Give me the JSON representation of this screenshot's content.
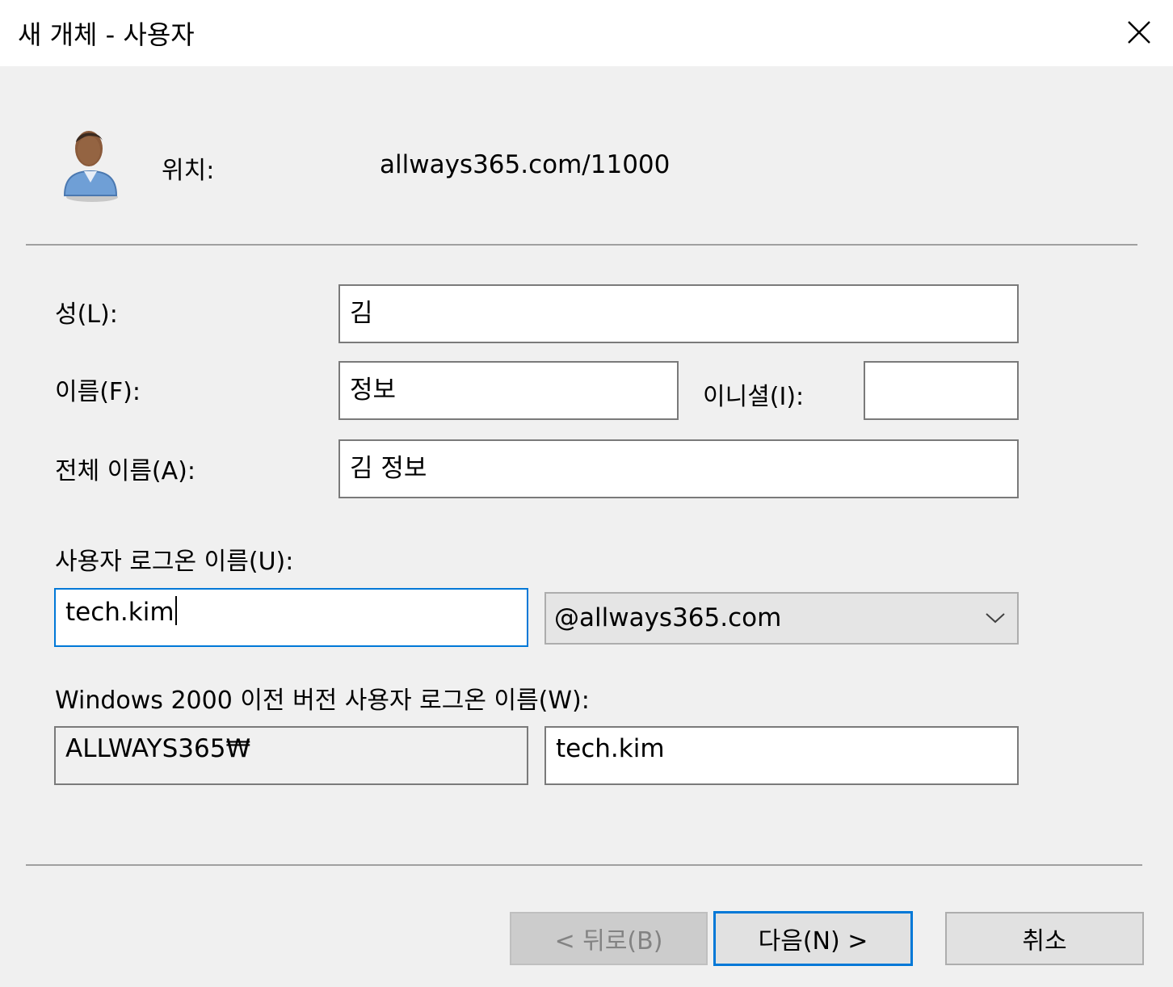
{
  "window": {
    "title": "새 개체 - 사용자",
    "close_icon": "close-icon"
  },
  "location": {
    "icon": "user-icon",
    "label": "위치:",
    "value": "allways365.com/11000"
  },
  "fields": {
    "last_name": {
      "label": "성(L):",
      "value": "김"
    },
    "first_name": {
      "label": "이름(F):",
      "value": "정보"
    },
    "initials": {
      "label": "이니셜(I):",
      "value": ""
    },
    "full_name": {
      "label": "전체 이름(A):",
      "value": "김 정보"
    },
    "logon_name": {
      "label": "사용자 로그온 이름(U):",
      "value": "tech.kim",
      "domain_selected": "@allways365.com"
    },
    "pre_windows2000": {
      "label": "Windows 2000 이전 버전 사용자 로그온 이름(W):",
      "domain_prefix": "ALLWAYS365₩",
      "value": "tech.kim"
    }
  },
  "buttons": {
    "back": "< 뒤로(B)",
    "next": "다음(N) >",
    "cancel": "취소"
  },
  "colors": {
    "focus_border": "#0078d7",
    "dialog_bg": "#f0f0f0"
  }
}
